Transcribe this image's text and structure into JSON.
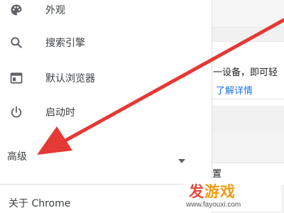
{
  "drawer": {
    "items": [
      {
        "label": "外观",
        "icon": "palette-icon"
      },
      {
        "label": "搜索引擎",
        "icon": "search-icon"
      },
      {
        "label": "默认浏览器",
        "icon": "browser-window-icon"
      },
      {
        "label": "启动时",
        "icon": "power-icon"
      }
    ],
    "advanced_label": "高级",
    "about_label": "关于 Chrome"
  },
  "content": {
    "line1": "一设备，即可轻",
    "link": "了解详情",
    "line2": "置"
  },
  "annotation": {
    "arrow_color": "#e53935"
  },
  "watermark": {
    "logo_part1": "发",
    "logo_part2": "游戏",
    "url": "www.fayouxi.com"
  },
  "colors": {
    "text": "#3c4043",
    "icon": "#5f6368",
    "link": "#1a73e8",
    "watermark_red": "#e74c3c",
    "watermark_orange": "#f39c12"
  }
}
